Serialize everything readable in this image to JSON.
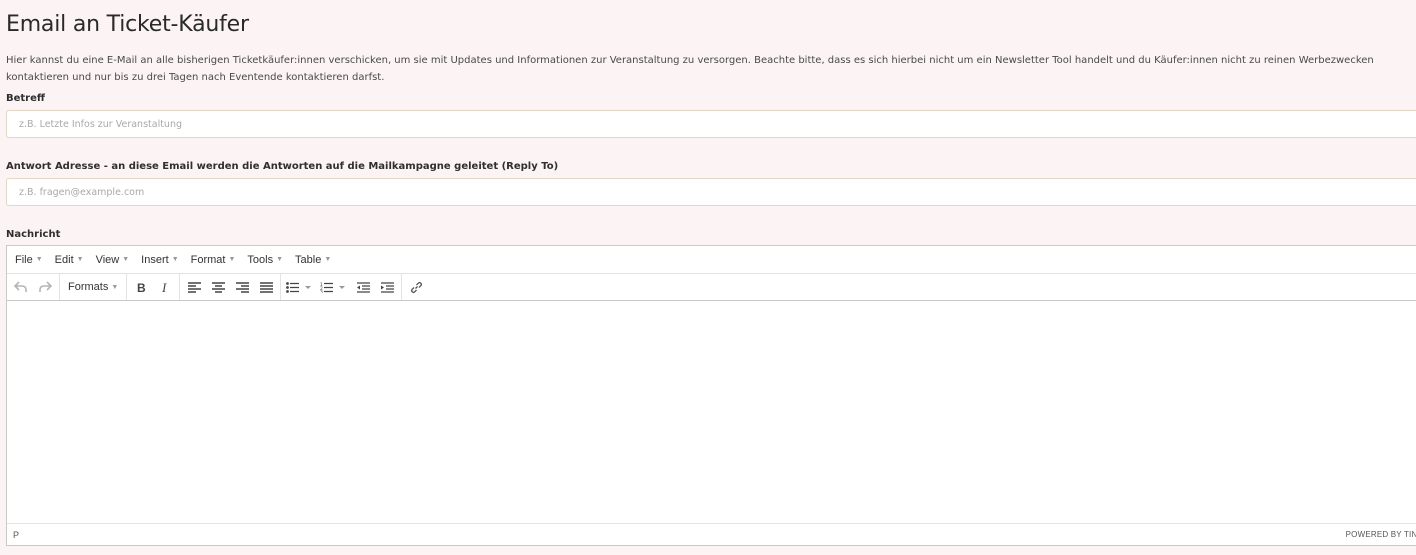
{
  "page": {
    "title": "Email an Ticket-Käufer",
    "description": "Hier kannst du eine E-Mail an alle bisherigen Ticketkäufer:innen verschicken, um sie mit Updates und Informationen zur Veranstaltung zu versorgen. Beachte bitte, dass es sich hierbei nicht um ein Newsletter Tool handelt und du Käufer:innen nicht zu reinen Werbezwecken kontaktieren und nur bis zu drei Tagen nach Eventende kontaktieren darfst."
  },
  "subject": {
    "label": "Betreff",
    "value": "",
    "placeholder": "z.B. Letzte Infos zur Veranstaltung"
  },
  "reply_to": {
    "label": "Antwort Adresse - an diese Email werden die Antworten auf die Mailkampagne geleitet (Reply To)",
    "value": "",
    "placeholder": "z.B. fragen@example.com"
  },
  "message": {
    "label": "Nachricht",
    "menubar": [
      "File",
      "Edit",
      "View",
      "Insert",
      "Format",
      "Tools",
      "Table"
    ],
    "formats_label": "Formats",
    "status_path": "P",
    "powered_by": "POWERED BY TINY"
  },
  "colors": {
    "background": "#fbf3f4",
    "field_border": "#e2d6c6",
    "icon": "#555555",
    "icon_disabled": "#b5b5b5"
  },
  "icons": [
    "undo-icon",
    "redo-icon",
    "bold-icon",
    "italic-icon",
    "align-left-icon",
    "align-center-icon",
    "align-right-icon",
    "align-justify-icon",
    "bullet-list-icon",
    "numbered-list-icon",
    "outdent-icon",
    "indent-icon",
    "link-icon"
  ]
}
